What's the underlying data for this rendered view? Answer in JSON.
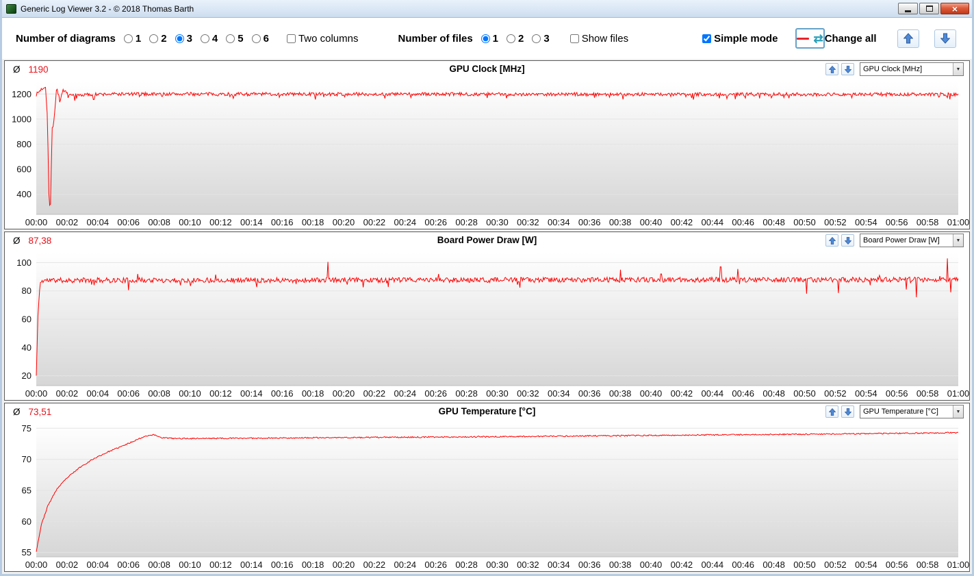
{
  "window": {
    "title": "Generic Log Viewer 3.2 - © 2018 Thomas Barth"
  },
  "toolbar": {
    "number_of_diagrams": {
      "label": "Number of diagrams",
      "options": [
        "1",
        "2",
        "3",
        "4",
        "5",
        "6"
      ],
      "selected": "3"
    },
    "two_columns": {
      "label": "Two columns",
      "checked": false
    },
    "number_of_files": {
      "label": "Number of files",
      "options": [
        "1",
        "2",
        "3"
      ],
      "selected": "1"
    },
    "show_files": {
      "label": "Show files",
      "checked": false
    },
    "simple_mode": {
      "label": "Simple mode",
      "checked": true
    },
    "change_all_label": "Change all"
  },
  "chart_data": [
    {
      "type": "line",
      "title": "GPU Clock [MHz]",
      "avg_prefix": "Ø",
      "average": "1190",
      "dropdown_value": "GPU Clock [MHz]",
      "series_color": "#ff0000",
      "ylim": [
        240,
        1300
      ],
      "yticks": [
        400,
        600,
        800,
        1000,
        1200
      ],
      "x_range_seconds": [
        0,
        3600
      ],
      "x_ticks": [
        "00:00",
        "00:02",
        "00:04",
        "00:06",
        "00:08",
        "00:10",
        "00:12",
        "00:14",
        "00:16",
        "00:18",
        "00:20",
        "00:22",
        "00:24",
        "00:26",
        "00:28",
        "00:30",
        "00:32",
        "00:34",
        "00:36",
        "00:38",
        "00:40",
        "00:42",
        "00:44",
        "00:46",
        "00:48",
        "00:50",
        "00:52",
        "00:54",
        "00:56",
        "00:58",
        "01:00"
      ],
      "keypoints": [
        [
          0,
          1195
        ],
        [
          18,
          1235
        ],
        [
          36,
          1262
        ],
        [
          44,
          1000
        ],
        [
          50,
          300
        ],
        [
          56,
          320
        ],
        [
          62,
          940
        ],
        [
          70,
          1010
        ],
        [
          80,
          1262
        ],
        [
          92,
          1140
        ],
        [
          105,
          1235
        ],
        [
          125,
          1190
        ],
        [
          300,
          1200
        ],
        [
          3600,
          1197
        ]
      ],
      "spikes": [],
      "noise": 14,
      "dip_chance": 0.035,
      "seed": 7
    },
    {
      "type": "line",
      "title": "Board Power Draw [W]",
      "avg_prefix": "Ø",
      "average": "87,38",
      "dropdown_value": "Board Power Draw [W]",
      "series_color": "#ff0000",
      "ylim": [
        13,
        107
      ],
      "yticks": [
        20,
        40,
        60,
        80,
        100
      ],
      "x_range_seconds": [
        0,
        3600
      ],
      "x_ticks": [
        "00:00",
        "00:02",
        "00:04",
        "00:06",
        "00:08",
        "00:10",
        "00:12",
        "00:14",
        "00:16",
        "00:18",
        "00:20",
        "00:22",
        "00:24",
        "00:26",
        "00:28",
        "00:30",
        "00:32",
        "00:34",
        "00:36",
        "00:38",
        "00:40",
        "00:42",
        "00:44",
        "00:46",
        "00:48",
        "00:50",
        "00:52",
        "00:54",
        "00:56",
        "00:58",
        "01:00"
      ],
      "keypoints": [
        [
          0,
          20
        ],
        [
          8,
          70
        ],
        [
          16,
          86
        ],
        [
          30,
          87.5
        ],
        [
          3600,
          88
        ]
      ],
      "spikes": [
        [
          360,
          80.5
        ],
        [
          397,
          92
        ],
        [
          700,
          91.5
        ],
        [
          1139,
          100.5
        ],
        [
          1570,
          92
        ],
        [
          2281,
          95
        ],
        [
          2440,
          92
        ],
        [
          2672,
          97
        ],
        [
          2738,
          95.5
        ],
        [
          3007,
          78
        ],
        [
          3062,
          86.5
        ],
        [
          3132,
          78.5
        ],
        [
          3292,
          91
        ],
        [
          3398,
          81
        ],
        [
          3436,
          75.5
        ],
        [
          3529,
          90.5
        ],
        [
          3558,
          103
        ],
        [
          3571,
          79
        ]
      ],
      "noise": 1.8,
      "dip_chance": 0.012,
      "seed": 11
    },
    {
      "type": "line",
      "title": "GPU Temperature [°C]",
      "avg_prefix": "Ø",
      "average": "73,51",
      "dropdown_value": "GPU Temperature [°C]",
      "series_color": "#ff0000",
      "ylim": [
        54.3,
        75.7
      ],
      "yticks": [
        55,
        60,
        65,
        70,
        75
      ],
      "x_range_seconds": [
        0,
        3600
      ],
      "x_ticks": [
        "00:00",
        "00:02",
        "00:04",
        "00:06",
        "00:08",
        "00:10",
        "00:12",
        "00:14",
        "00:16",
        "00:18",
        "00:20",
        "00:22",
        "00:24",
        "00:26",
        "00:28",
        "00:30",
        "00:32",
        "00:34",
        "00:36",
        "00:38",
        "00:40",
        "00:42",
        "00:44",
        "00:46",
        "00:48",
        "00:50",
        "00:52",
        "00:54",
        "00:56",
        "00:58",
        "01:00"
      ],
      "keypoints": [
        [
          0,
          55.2
        ],
        [
          20,
          59.5
        ],
        [
          45,
          62.5
        ],
        [
          80,
          65.2
        ],
        [
          120,
          67
        ],
        [
          170,
          68.7
        ],
        [
          220,
          70
        ],
        [
          280,
          71.2
        ],
        [
          340,
          72.2
        ],
        [
          400,
          73.3
        ],
        [
          430,
          73.8
        ],
        [
          460,
          73.95
        ],
        [
          490,
          73.5
        ],
        [
          540,
          73.35
        ],
        [
          800,
          73.4
        ],
        [
          1200,
          73.5
        ],
        [
          1800,
          73.65
        ],
        [
          2400,
          73.85
        ],
        [
          3000,
          74.05
        ],
        [
          3300,
          74.15
        ],
        [
          3600,
          74.3
        ]
      ],
      "spikes": [],
      "noise": 0.1,
      "dip_chance": 0,
      "seed": 23
    }
  ]
}
